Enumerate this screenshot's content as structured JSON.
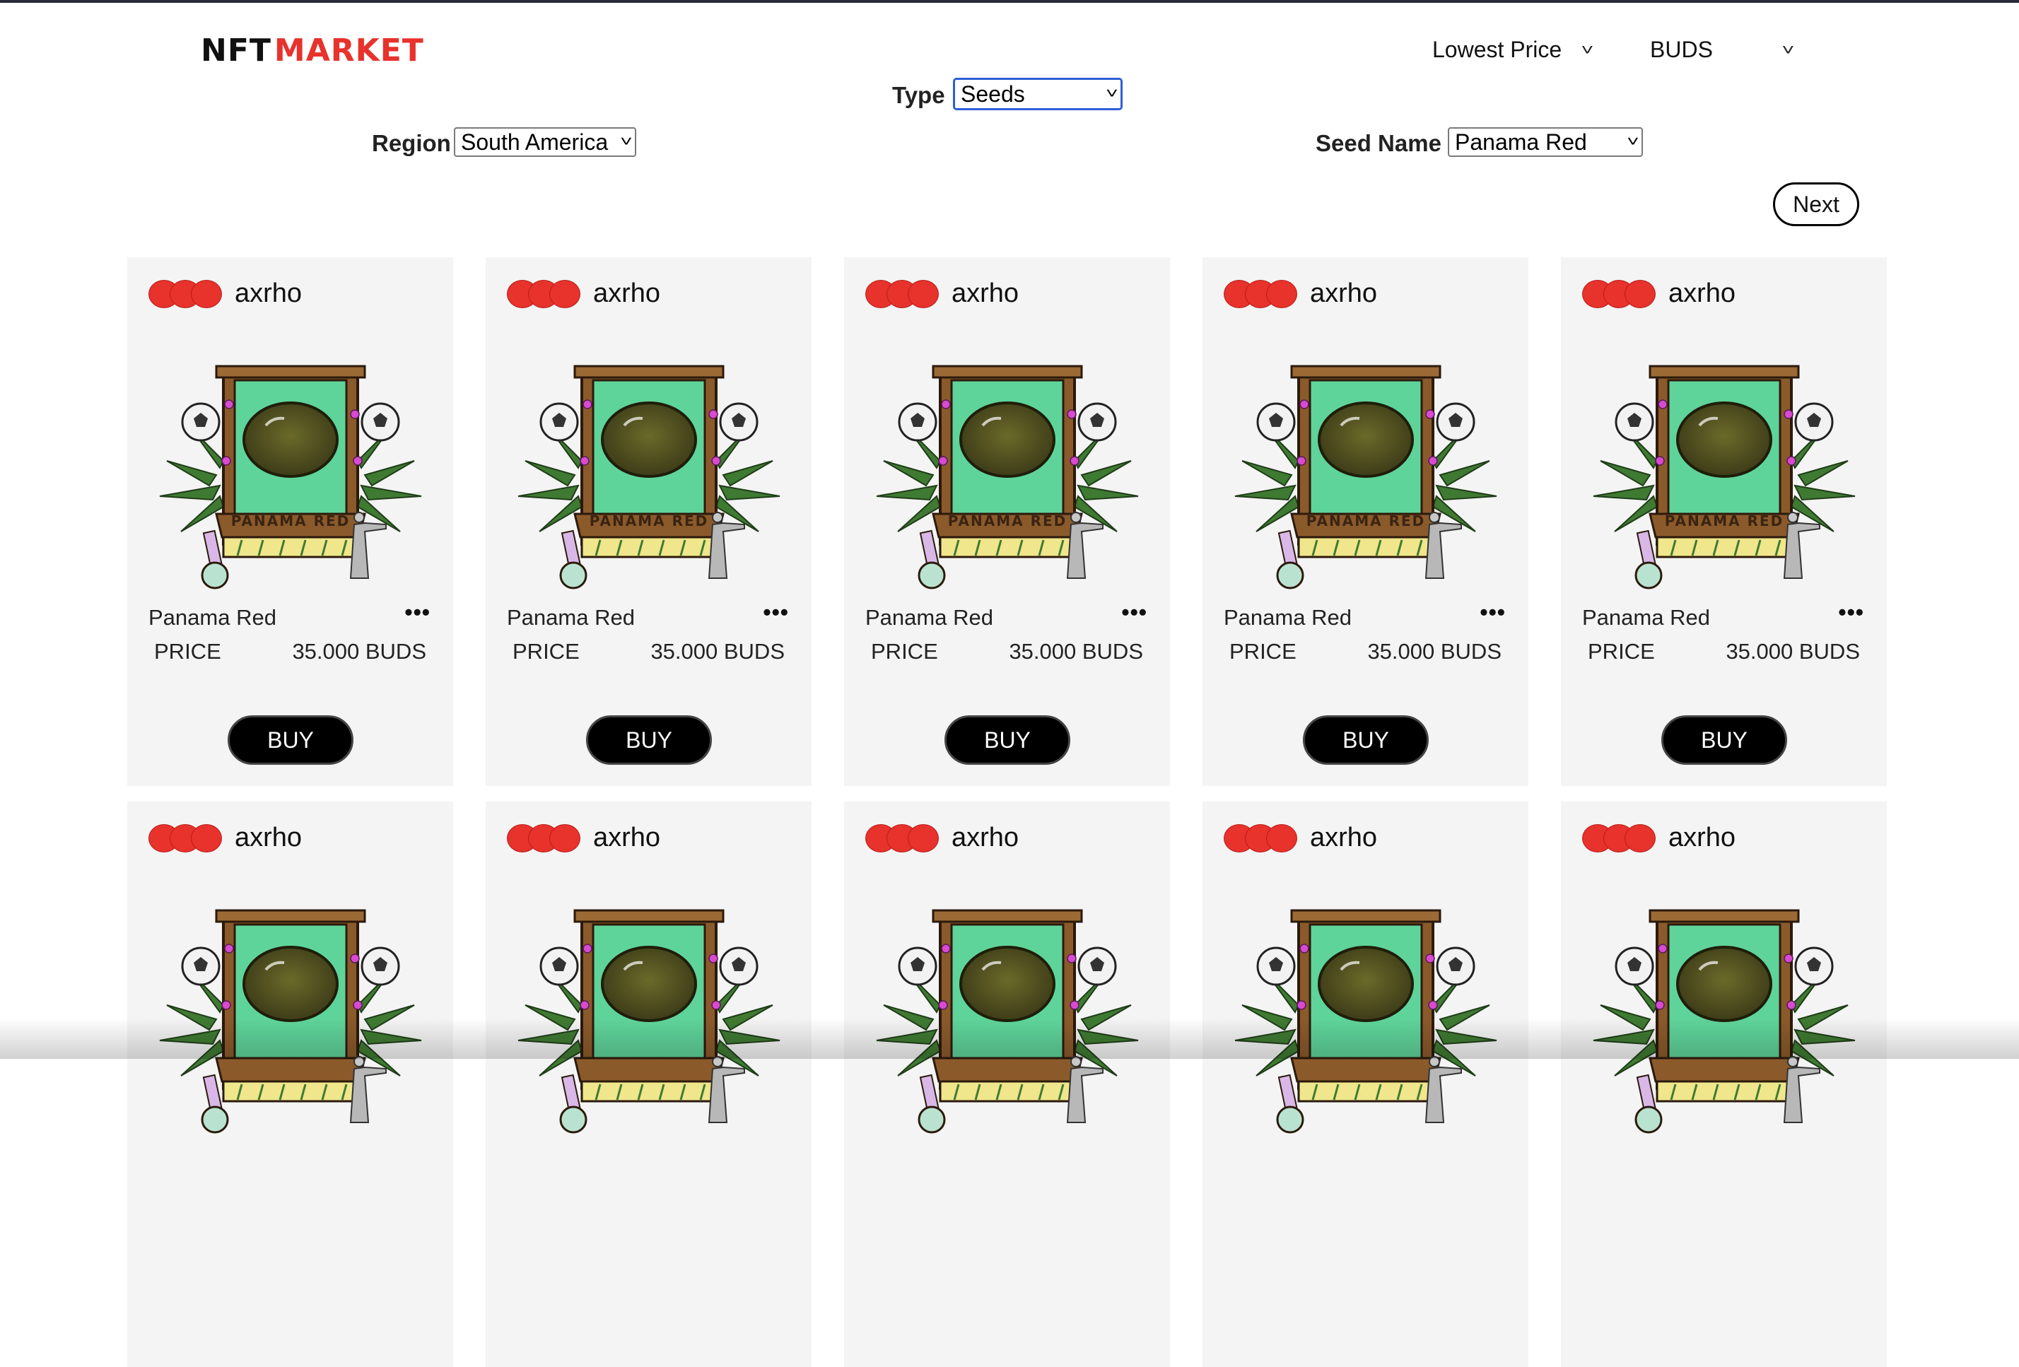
{
  "header": {
    "logo_nft": "NFT",
    "logo_market": "MARKET",
    "sort_label": "Lowest Price",
    "currency_label": "BUDS"
  },
  "filters": {
    "type_label": "Type",
    "type_value": "Seeds",
    "region_label": "Region",
    "region_value": "South America",
    "seed_label": "Seed Name",
    "seed_value": "Panama Red"
  },
  "pagination": {
    "next_label": "Next"
  },
  "cards": [
    {
      "owner": "axrho",
      "name": "Panama Red",
      "price_label": "PRICE",
      "price": "35.000 BUDS",
      "buy_label": "BUY",
      "more": "•••",
      "art_banner": "PANAMA RED"
    },
    {
      "owner": "axrho",
      "name": "Panama Red",
      "price_label": "PRICE",
      "price": "35.000 BUDS",
      "buy_label": "BUY",
      "more": "•••",
      "art_banner": "PANAMA RED"
    },
    {
      "owner": "axrho",
      "name": "Panama Red",
      "price_label": "PRICE",
      "price": "35.000 BUDS",
      "buy_label": "BUY",
      "more": "•••",
      "art_banner": "PANAMA RED"
    },
    {
      "owner": "axrho",
      "name": "Panama Red",
      "price_label": "PRICE",
      "price": "35.000 BUDS",
      "buy_label": "BUY",
      "more": "•••",
      "art_banner": "PANAMA RED"
    },
    {
      "owner": "axrho",
      "name": "Panama Red",
      "price_label": "PRICE",
      "price": "35.000 BUDS",
      "buy_label": "BUY",
      "more": "•••",
      "art_banner": "PANAMA RED"
    },
    {
      "owner": "axrho"
    },
    {
      "owner": "axrho"
    },
    {
      "owner": "axrho"
    },
    {
      "owner": "axrho"
    },
    {
      "owner": "axrho"
    }
  ],
  "colors": {
    "brand_red": "#e8322c",
    "card_bg": "#f4f4f4",
    "art_green": "#5fd49a"
  }
}
